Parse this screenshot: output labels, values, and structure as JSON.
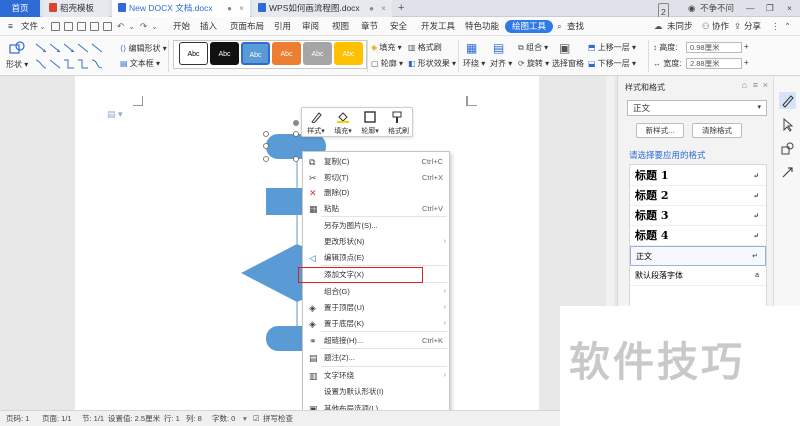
{
  "tabs": {
    "home": "首页",
    "t1": "稻壳模板",
    "t2": "New DOCX 文档.docx",
    "t3": "WPS如何画流程图.docx",
    "add": "+",
    "badge": "2",
    "user": "不争不问"
  },
  "menu": {
    "file": "文件",
    "items": [
      "开始",
      "插入",
      "页面布局",
      "引用",
      "审阅",
      "视图",
      "章节",
      "安全",
      "开发工具",
      "特色功能"
    ],
    "active": "绘图工具",
    "search": "查找",
    "sync": "未同步",
    "collab": "协作",
    "share": "分享"
  },
  "ribbon": {
    "shape": "形状",
    "edit_shape": "编辑形状",
    "textbox": "文本框",
    "style_text": "Abc",
    "style_colors": [
      {
        "bg": "#ffffff",
        "fg": "#000000",
        "border": "#333333"
      },
      {
        "bg": "#111111",
        "fg": "#ffffff",
        "border": "#111111"
      },
      {
        "bg": "#5b9bd5",
        "fg": "#ffffff",
        "border": "#2f6bd6"
      },
      {
        "bg": "#ed7d31",
        "fg": "#ffffff",
        "border": "#ed7d31"
      },
      {
        "bg": "#a5a5a5",
        "fg": "#ffffff",
        "border": "#a5a5a5"
      },
      {
        "bg": "#ffc000",
        "fg": "#ffffff",
        "border": "#ffc000"
      }
    ],
    "fill": "填充",
    "format_painter": "格式刷",
    "outline": "轮廓",
    "shape_effect": "形状效果",
    "wrap": "环绕",
    "align": "对齐",
    "rotate": "旋转",
    "group": "组合",
    "select_pane": "选择窗格",
    "bring_forward": "上移一层",
    "send_backward": "下移一层",
    "height_label": "高度:",
    "height_value": "0.98厘米",
    "width_label": "宽度:",
    "width_value": "2.88厘米"
  },
  "minibar": {
    "style": "样式",
    "fill": "填充",
    "outline": "轮廓",
    "format_painter": "格式刷"
  },
  "context_menu": [
    {
      "label": "复制(C)",
      "shortcut": "Ctrl+C",
      "icon": "copy-icon"
    },
    {
      "label": "剪切(T)",
      "shortcut": "Ctrl+X",
      "icon": "cut-icon"
    },
    {
      "label": "删除(D)",
      "shortcut": "",
      "icon": "delete-icon"
    },
    {
      "label": "粘贴",
      "shortcut": "Ctrl+V",
      "icon": "paste-icon"
    },
    {
      "label": "另存为图片(S)...",
      "shortcut": "",
      "icon": ""
    },
    {
      "label": "更改形状(N)",
      "shortcut": "",
      "icon": "",
      "submenu": true
    },
    {
      "label": "编辑顶点(E)",
      "shortcut": "",
      "icon": "edit-points-icon"
    },
    {
      "label": "添加文字(X)",
      "shortcut": "",
      "icon": ""
    },
    {
      "label": "组合(G)",
      "shortcut": "",
      "icon": "",
      "submenu": true
    },
    {
      "label": "置于顶层(U)",
      "shortcut": "",
      "icon": "bring-front-icon",
      "submenu": true
    },
    {
      "label": "置于底层(K)",
      "shortcut": "",
      "icon": "send-back-icon",
      "submenu": true
    },
    {
      "label": "超链接(H)...",
      "shortcut": "Ctrl+K",
      "icon": "link-icon"
    },
    {
      "label": "题注(Z)...",
      "shortcut": "",
      "icon": "caption-icon"
    },
    {
      "label": "文字环绕",
      "shortcut": "",
      "icon": "wrap-icon",
      "submenu": true
    },
    {
      "label": "设置为默认形状(I)",
      "shortcut": "",
      "icon": ""
    },
    {
      "label": "其他布局选项(L)...",
      "shortcut": "",
      "icon": "layout-icon"
    }
  ],
  "panel": {
    "title": "样式和格式",
    "current_style": "正文",
    "new_style": "新样式...",
    "clear_format": "清除格式",
    "select_label": "请选择要应用的格式",
    "styles": [
      {
        "name": "标题  1",
        "mark": "↵"
      },
      {
        "name": "标题  2",
        "mark": "↵"
      },
      {
        "name": "标题  3",
        "mark": "↵"
      },
      {
        "name": "标题  4",
        "mark": "↵"
      },
      {
        "name": "正文",
        "mark": "↵"
      },
      {
        "name": "默认段落字体",
        "mark": "a"
      }
    ]
  },
  "status": {
    "page": "页码: 1",
    "pages": "页面: 1/1",
    "section": "节: 1/1",
    "position": "设置值: 2.5厘米",
    "row": "行: 1",
    "col": "列: 8",
    "words": "字数: 0",
    "spellcheck": "拼写检查"
  },
  "watermark": "软件技巧",
  "colors": {
    "accent": "#2f7ae5",
    "shape_fill": "#5b9bd5",
    "highlight_box": "#dd2222"
  }
}
